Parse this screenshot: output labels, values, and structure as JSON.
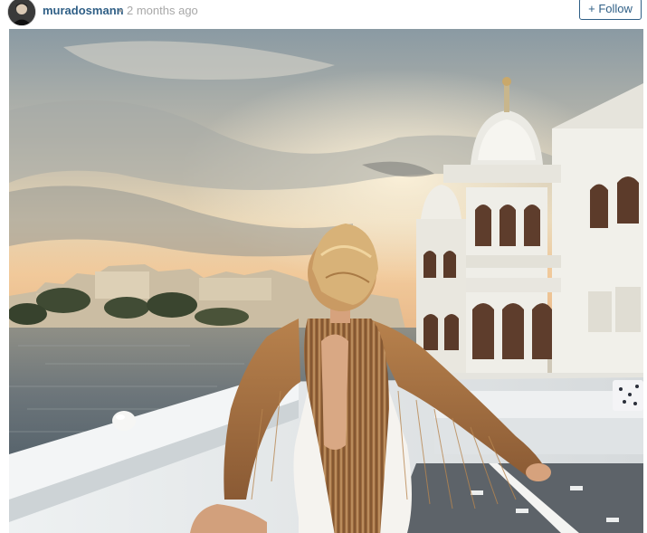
{
  "post": {
    "username": "muradosmann",
    "separator": "•",
    "timestamp": "2 months ago",
    "follow_label": "+ Follow"
  },
  "icons": {
    "avatar": "avatar-icon"
  },
  "colors": {
    "link_blue": "#2f5f86",
    "muted_gray": "#a8a8a8"
  }
}
